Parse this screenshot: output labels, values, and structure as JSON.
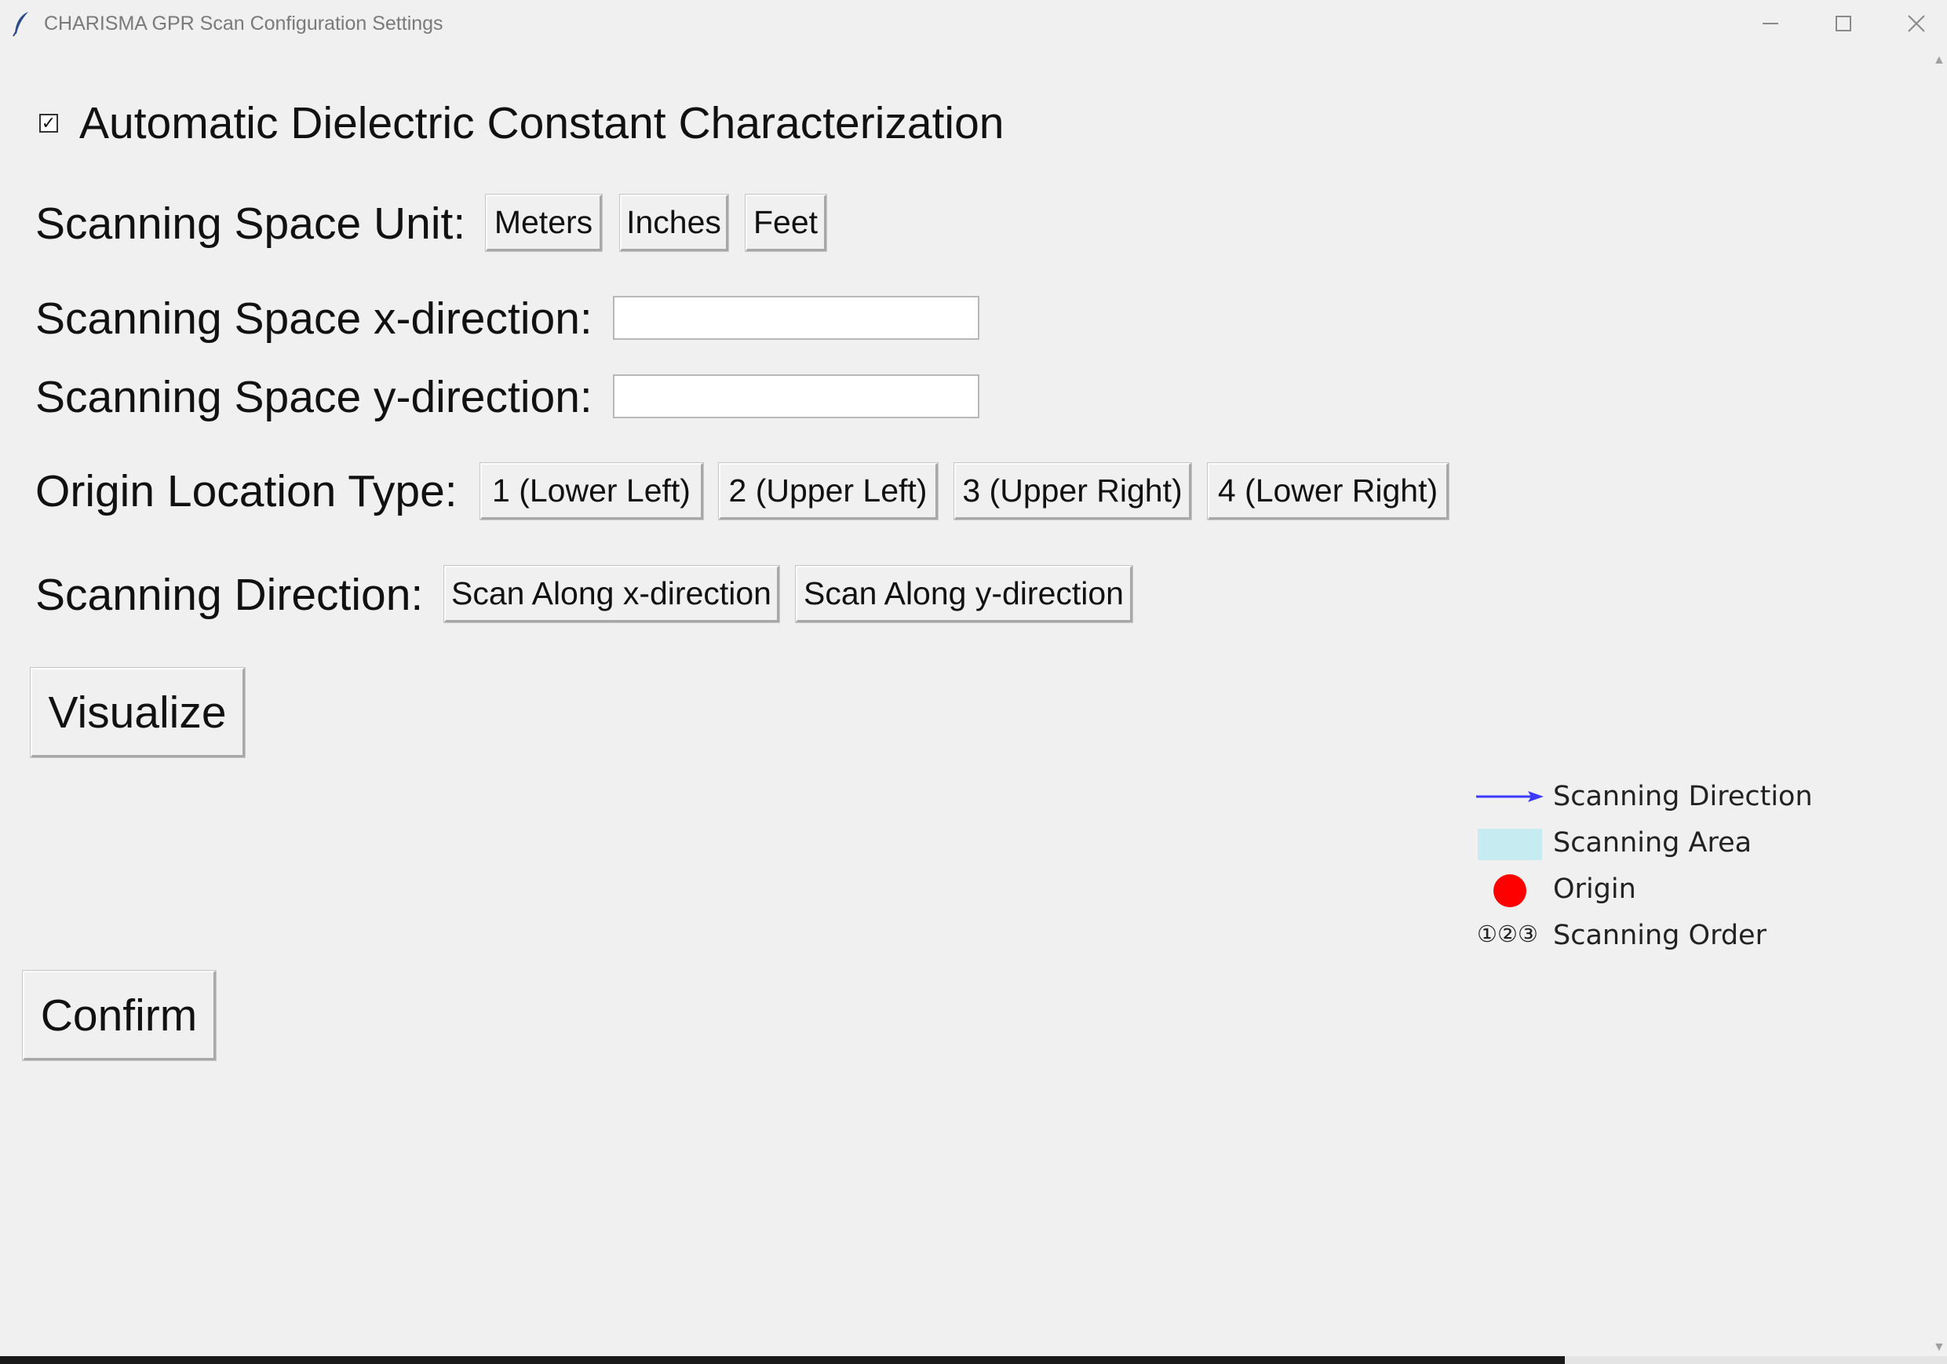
{
  "window": {
    "title": "CHARISMA GPR Scan Configuration Settings",
    "minimize_glyph": "–",
    "maximize_glyph": "☐",
    "close_glyph": "✕"
  },
  "auto_dielectric": {
    "label": "Automatic Dielectric Constant Characterization",
    "checked": true,
    "check_glyph": "✓"
  },
  "scan_unit": {
    "label": "Scanning Space Unit:",
    "options": [
      "Meters",
      "Inches",
      "Feet"
    ]
  },
  "x_direction": {
    "label": "Scanning Space x-direction:",
    "value": ""
  },
  "y_direction": {
    "label": "Scanning Space y-direction:",
    "value": ""
  },
  "origin": {
    "label": "Origin Location Type:",
    "options": [
      "1 (Lower Left)",
      "2 (Upper Left)",
      "3 (Upper Right)",
      "4 (Lower Right)"
    ]
  },
  "scan_direction": {
    "label": "Scanning Direction:",
    "options": [
      "Scan Along x-direction",
      "Scan Along y-direction"
    ]
  },
  "visualize_label": "Visualize",
  "confirm_label": "Confirm",
  "legend": {
    "direction": "Scanning Direction",
    "area": "Scanning Area",
    "origin": "Origin",
    "order": "Scanning Order",
    "order_symbol": "①②③",
    "arrow_color": "#3b3bff",
    "area_color": "#c6ecf2",
    "origin_color": "#ff0000"
  }
}
